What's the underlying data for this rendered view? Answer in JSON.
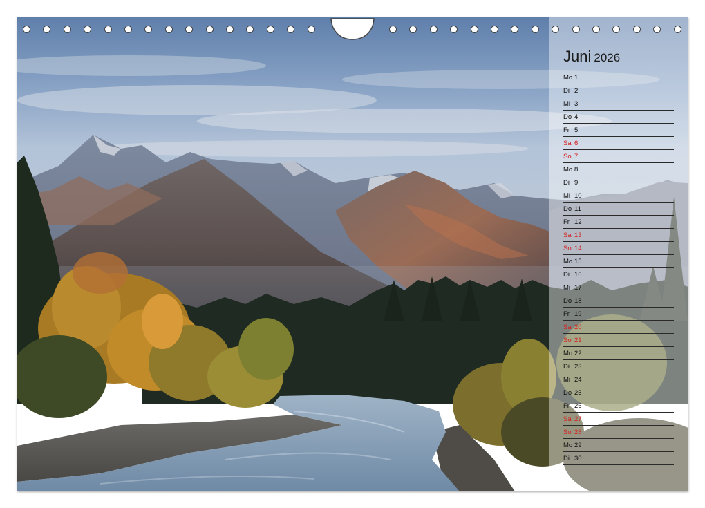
{
  "calendar": {
    "month": "Juni",
    "year": "2026",
    "days": [
      {
        "wd": "Mo",
        "d": "1",
        "weekend": false
      },
      {
        "wd": "Di",
        "d": "2",
        "weekend": false
      },
      {
        "wd": "Mi",
        "d": "3",
        "weekend": false
      },
      {
        "wd": "Do",
        "d": "4",
        "weekend": false
      },
      {
        "wd": "Fr",
        "d": "5",
        "weekend": false
      },
      {
        "wd": "Sa",
        "d": "6",
        "weekend": true
      },
      {
        "wd": "So",
        "d": "7",
        "weekend": true
      },
      {
        "wd": "Mo",
        "d": "8",
        "weekend": false
      },
      {
        "wd": "Di",
        "d": "9",
        "weekend": false
      },
      {
        "wd": "Mi",
        "d": "10",
        "weekend": false
      },
      {
        "wd": "Do",
        "d": "11",
        "weekend": false
      },
      {
        "wd": "Fr",
        "d": "12",
        "weekend": false
      },
      {
        "wd": "Sa",
        "d": "13",
        "weekend": true
      },
      {
        "wd": "So",
        "d": "14",
        "weekend": true
      },
      {
        "wd": "Mo",
        "d": "15",
        "weekend": false
      },
      {
        "wd": "Di",
        "d": "16",
        "weekend": false
      },
      {
        "wd": "Mi",
        "d": "17",
        "weekend": false
      },
      {
        "wd": "Do",
        "d": "18",
        "weekend": false
      },
      {
        "wd": "Fr",
        "d": "19",
        "weekend": false
      },
      {
        "wd": "Sa",
        "d": "20",
        "weekend": true
      },
      {
        "wd": "So",
        "d": "21",
        "weekend": true
      },
      {
        "wd": "Mo",
        "d": "22",
        "weekend": false
      },
      {
        "wd": "Di",
        "d": "23",
        "weekend": false
      },
      {
        "wd": "Mi",
        "d": "24",
        "weekend": false
      },
      {
        "wd": "Do",
        "d": "25",
        "weekend": false
      },
      {
        "wd": "Fr",
        "d": "26",
        "weekend": false
      },
      {
        "wd": "Sa",
        "d": "27",
        "weekend": true
      },
      {
        "wd": "So",
        "d": "28",
        "weekend": true
      },
      {
        "wd": "Mo",
        "d": "29",
        "weekend": false
      },
      {
        "wd": "Di",
        "d": "30",
        "weekend": false
      }
    ]
  },
  "colors": {
    "weekend": "#d42020",
    "weekday": "#111111",
    "sky_top": "#6f8fb8",
    "autumn_foliage": "#c48a28",
    "river": "#8fa8bf"
  },
  "photo": {
    "subject": "mountain-river-landscape"
  }
}
